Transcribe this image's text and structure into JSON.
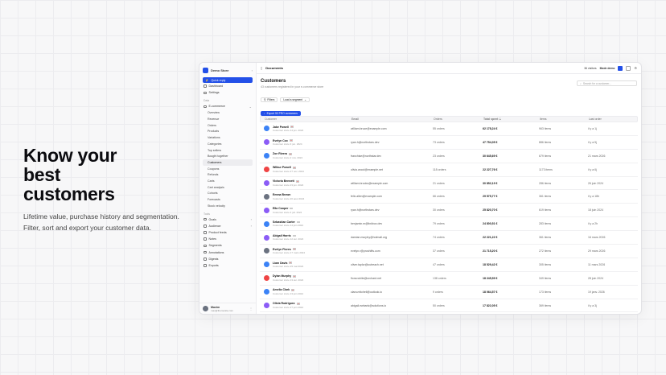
{
  "hero": {
    "title_lines": [
      "Know your",
      "best",
      "customers"
    ],
    "sub_lines": [
      "Lifetime value, purchase history and segmentation.",
      "Filter, sort and export your customer data."
    ]
  },
  "sidebar": {
    "store_name": "Demo Store",
    "quick": "Quick reply",
    "top_items": [
      "Dashboard",
      "Settings"
    ],
    "section_data": "Data",
    "ecommerce_label": "E-commerce",
    "ecommerce_sub": [
      "Overview",
      "Revenue",
      "Orders",
      "Products",
      "Variations",
      "Categories",
      "Top sellers",
      "Bought together",
      "Customers",
      "Coupons",
      "Refunds",
      "Carts",
      "Cart analysis",
      "Cohorts",
      "Forecasts",
      "Stock velocity"
    ],
    "active_sub": "Customers",
    "section_tools": "Tools",
    "tools": [
      "Goals",
      "Audience",
      "Product feeds",
      "Notes",
      "Segments",
      "Annotations",
      "Digests",
      "Exports"
    ],
    "user": {
      "name": "Maxim",
      "email": "max@themeisle.com"
    }
  },
  "topbar": {
    "breadcrumb": "Documents",
    "visitors": "36 visitors",
    "mode": "Mode demo"
  },
  "page": {
    "title": "Customers",
    "subtitle": "43 customers registered in your e-commerce store",
    "search_placeholder": "Search for a customer..."
  },
  "filters": {
    "filters_label": "Filters",
    "segment_label": "Load a segment",
    "export_label": "Export 50 PRO customers"
  },
  "table": {
    "columns": [
      "Customer",
      "Email",
      "Orders",
      "Total spent",
      "Items",
      "Last order"
    ],
    "rows": [
      {
        "name": "Jake Powell",
        "since": "Customer since 14 jun. 2024",
        "email": "william.bruce@example.com",
        "orders": "55 orders",
        "spent": "62 178,24 €",
        "items": "963 items",
        "last": "il y a 1j",
        "color": "#3b82f6",
        "flag": true
      },
      {
        "name": "Evelyn Cox",
        "since": "Customer since 3 jun. 2024",
        "email": "ryan.h@northstars.dev",
        "orders": "73 orders",
        "spent": "47 754,05 €",
        "items": "886 items",
        "last": "il y a 5j",
        "color": "#8b5cf6",
        "flag": true
      },
      {
        "name": "Zoe Rivera",
        "since": "Customer since 2 nov. 2024",
        "email": "franchise@northstar.dev",
        "orders": "23 orders",
        "spent": "30 645,69 €",
        "items": "679 items",
        "last": "21 mars 2026",
        "color": "#3b82f6",
        "flag": true
      },
      {
        "name": "Wilbur Powell",
        "since": "Customer since 27 nov. 2024",
        "email": "olivia.wood@example.net",
        "orders": "118 orders",
        "spent": "22 227,76 €",
        "items": "1173 items",
        "last": "il y a 6j",
        "color": "#ef4444",
        "flag": true
      },
      {
        "name": "Victoria Bennett",
        "since": "Customer since 23 jun. 2024",
        "email": "william.brooks@example.com",
        "orders": "21 orders",
        "spent": "30 852,19 €",
        "items": "286 items",
        "last": "26 juin 2024",
        "color": "#8b5cf6",
        "flag": true
      },
      {
        "name": "Emma Brown",
        "since": "Customer since 20 aout 2024",
        "email": "felix.allen@example.com",
        "orders": "66 orders",
        "spent": "29 575,77 €",
        "items": "361 items",
        "last": "il y a 18h",
        "color": "#6b7280",
        "flag": false
      },
      {
        "name": "Ella Cooper",
        "since": "Customer since 4 juil. 2024",
        "email": "ryan.h@northstars.dev",
        "orders": "30 orders",
        "spent": "25 820,70 €",
        "items": "619 items",
        "last": "18 juin 2024",
        "color": "#8b5cf6",
        "flag": true
      },
      {
        "name": "Sebastian Carter",
        "since": "Customer since 14 juin 2024",
        "email": "benjamin.m@linkbox.dev",
        "orders": "79 orders",
        "spent": "24 800,51 €",
        "items": "283 items",
        "last": "il y a 2h",
        "color": "#3b82f6",
        "flag": true
      },
      {
        "name": "Abigail Harris",
        "since": "Customer since 12 avr. 2024",
        "email": "damian.murphy@hotmail.org",
        "orders": "74 orders",
        "spent": "22 221,22 €",
        "items": "361 items",
        "last": "16 mars 2026",
        "color": "#8b5cf6",
        "flag": true
      },
      {
        "name": "Evelyn Flores",
        "since": "Customer since 17 mars 2024",
        "email": "evelyn.r@proshifts.com",
        "orders": "37 orders",
        "spent": "21 715,20 €",
        "items": "272 items",
        "last": "29 mars 2026",
        "color": "#6b7280",
        "flag": true
      },
      {
        "name": "Liam Davis",
        "since": "Customer since 29 mai 2024",
        "email": "oliver.taylor@outreach.net",
        "orders": "47 orders",
        "spent": "18 529,42 €",
        "items": "305 items",
        "last": "11 mars 2026",
        "color": "#3b82f6",
        "flag": true
      },
      {
        "name": "Dylan Murphy",
        "since": "Customer since 13 avr. 2024",
        "email": "fiona.white@orchard.net",
        "orders": "138 orders",
        "spent": "18 245,59 €",
        "items": "349 items",
        "last": "28 juin 2024",
        "color": "#ef4444",
        "flag": true
      },
      {
        "name": "Amelia Clark",
        "since": "Customer since 13 juin 2024",
        "email": "clara.mitchell@outlook.io",
        "orders": "9 orders",
        "spent": "18 064,57 €",
        "items": "173 items",
        "last": "19 janv. 2026",
        "color": "#3b82f6",
        "flag": true
      },
      {
        "name": "Olivia Rodriguez",
        "since": "Customer since 27 juin 2024",
        "email": "abigail.ewbank@solutions.io",
        "orders": "50 orders",
        "spent": "17 822,05 €",
        "items": "369 items",
        "last": "il y a 3j",
        "color": "#8b5cf6",
        "flag": true
      }
    ]
  }
}
